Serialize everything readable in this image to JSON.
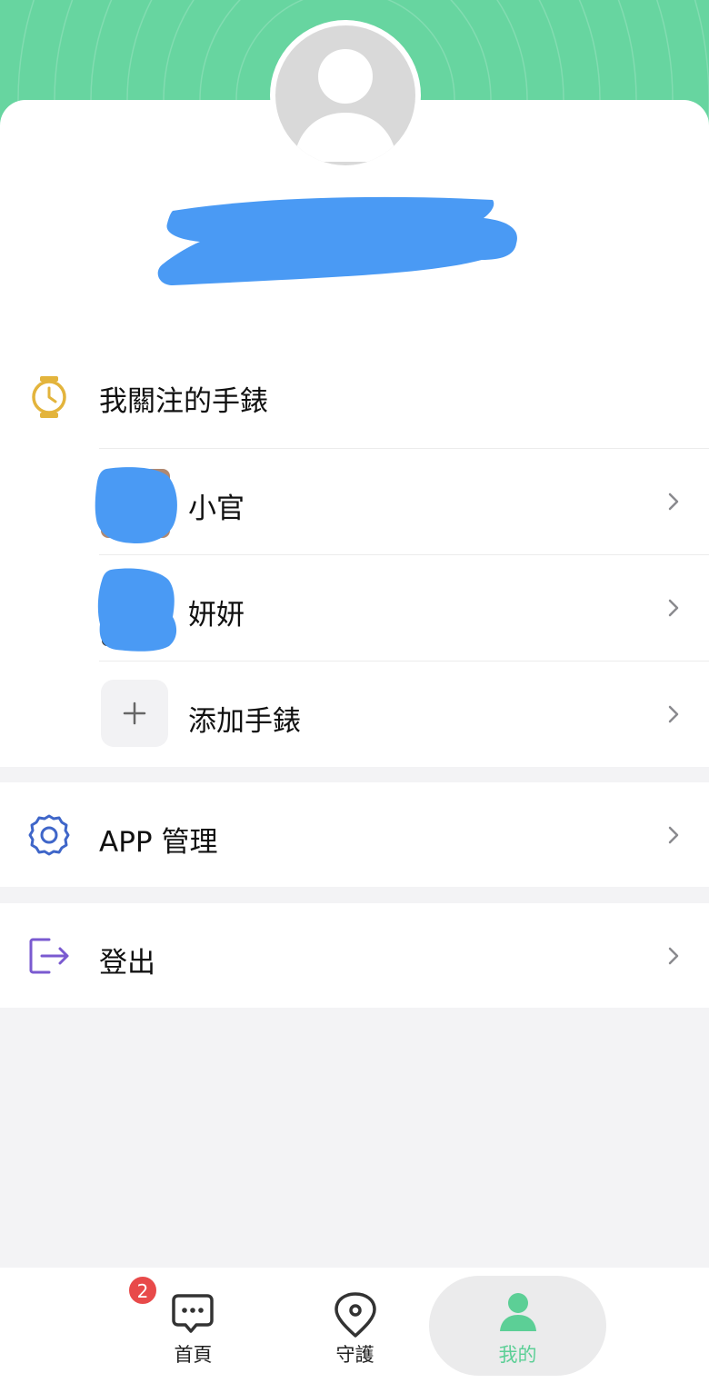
{
  "profile": {
    "avatar_icon": "default-user-avatar",
    "username_redacted": true
  },
  "watch_section": {
    "title": "我關注的手錶",
    "icon": "watch-icon",
    "watches": [
      {
        "name": "小官",
        "avatar_redacted": true
      },
      {
        "name": "妍妍",
        "avatar_redacted": true
      }
    ],
    "add_label": "添加手錶",
    "add_icon": "plus-icon"
  },
  "app_manage": {
    "label": "APP 管理",
    "icon": "gear-icon"
  },
  "logout": {
    "label": "登出",
    "icon": "logout-icon"
  },
  "tabbar": {
    "tabs": [
      {
        "label": "首頁",
        "icon": "chat-bubble-icon",
        "badge": "2"
      },
      {
        "label": "守護",
        "icon": "location-pin-icon"
      },
      {
        "label": "我的",
        "icon": "person-icon",
        "active": true
      }
    ]
  },
  "colors": {
    "header_green": "#67d5a0",
    "accent_green": "#5ccf96",
    "watch_icon_gold": "#e3b43c",
    "gear_blue": "#3f66c9",
    "logout_purple": "#7a5ad0",
    "badge_red": "#e84a4a",
    "redaction_blue": "#4a9af4"
  }
}
